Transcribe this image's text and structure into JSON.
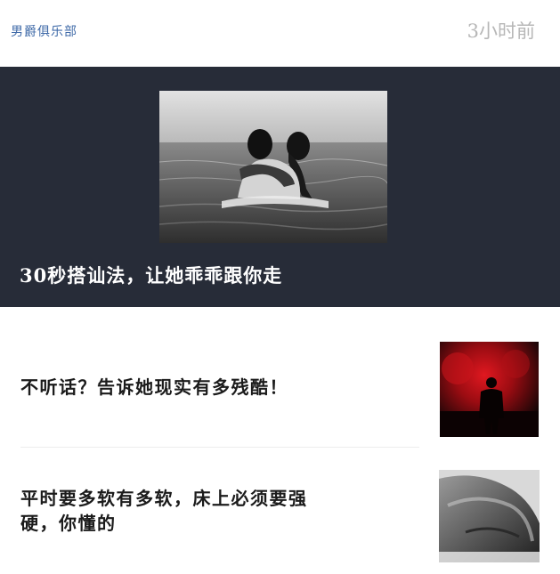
{
  "header": {
    "source_name": "男爵俱乐部",
    "timestamp": "3小时前"
  },
  "hero": {
    "title": "30秒搭讪法，让她乖乖跟你走",
    "image": "couple-kissing-in-sea-photo"
  },
  "articles": [
    {
      "title": "不听话？告诉她现实有多残酷！",
      "thumbnail": "man-silhouette-red-smoke-photo"
    },
    {
      "title": "平时要多软有多软，床上必须要强硬，你懂的",
      "thumbnail": "bare-back-monochrome-photo"
    }
  ],
  "colors": {
    "source_link": "#3f6aa8",
    "timestamp": "#b7b7b7",
    "hero_background": "#272c38",
    "hero_title": "#ffffff",
    "article_title": "#1b1b1b",
    "divider": "#ececec"
  }
}
